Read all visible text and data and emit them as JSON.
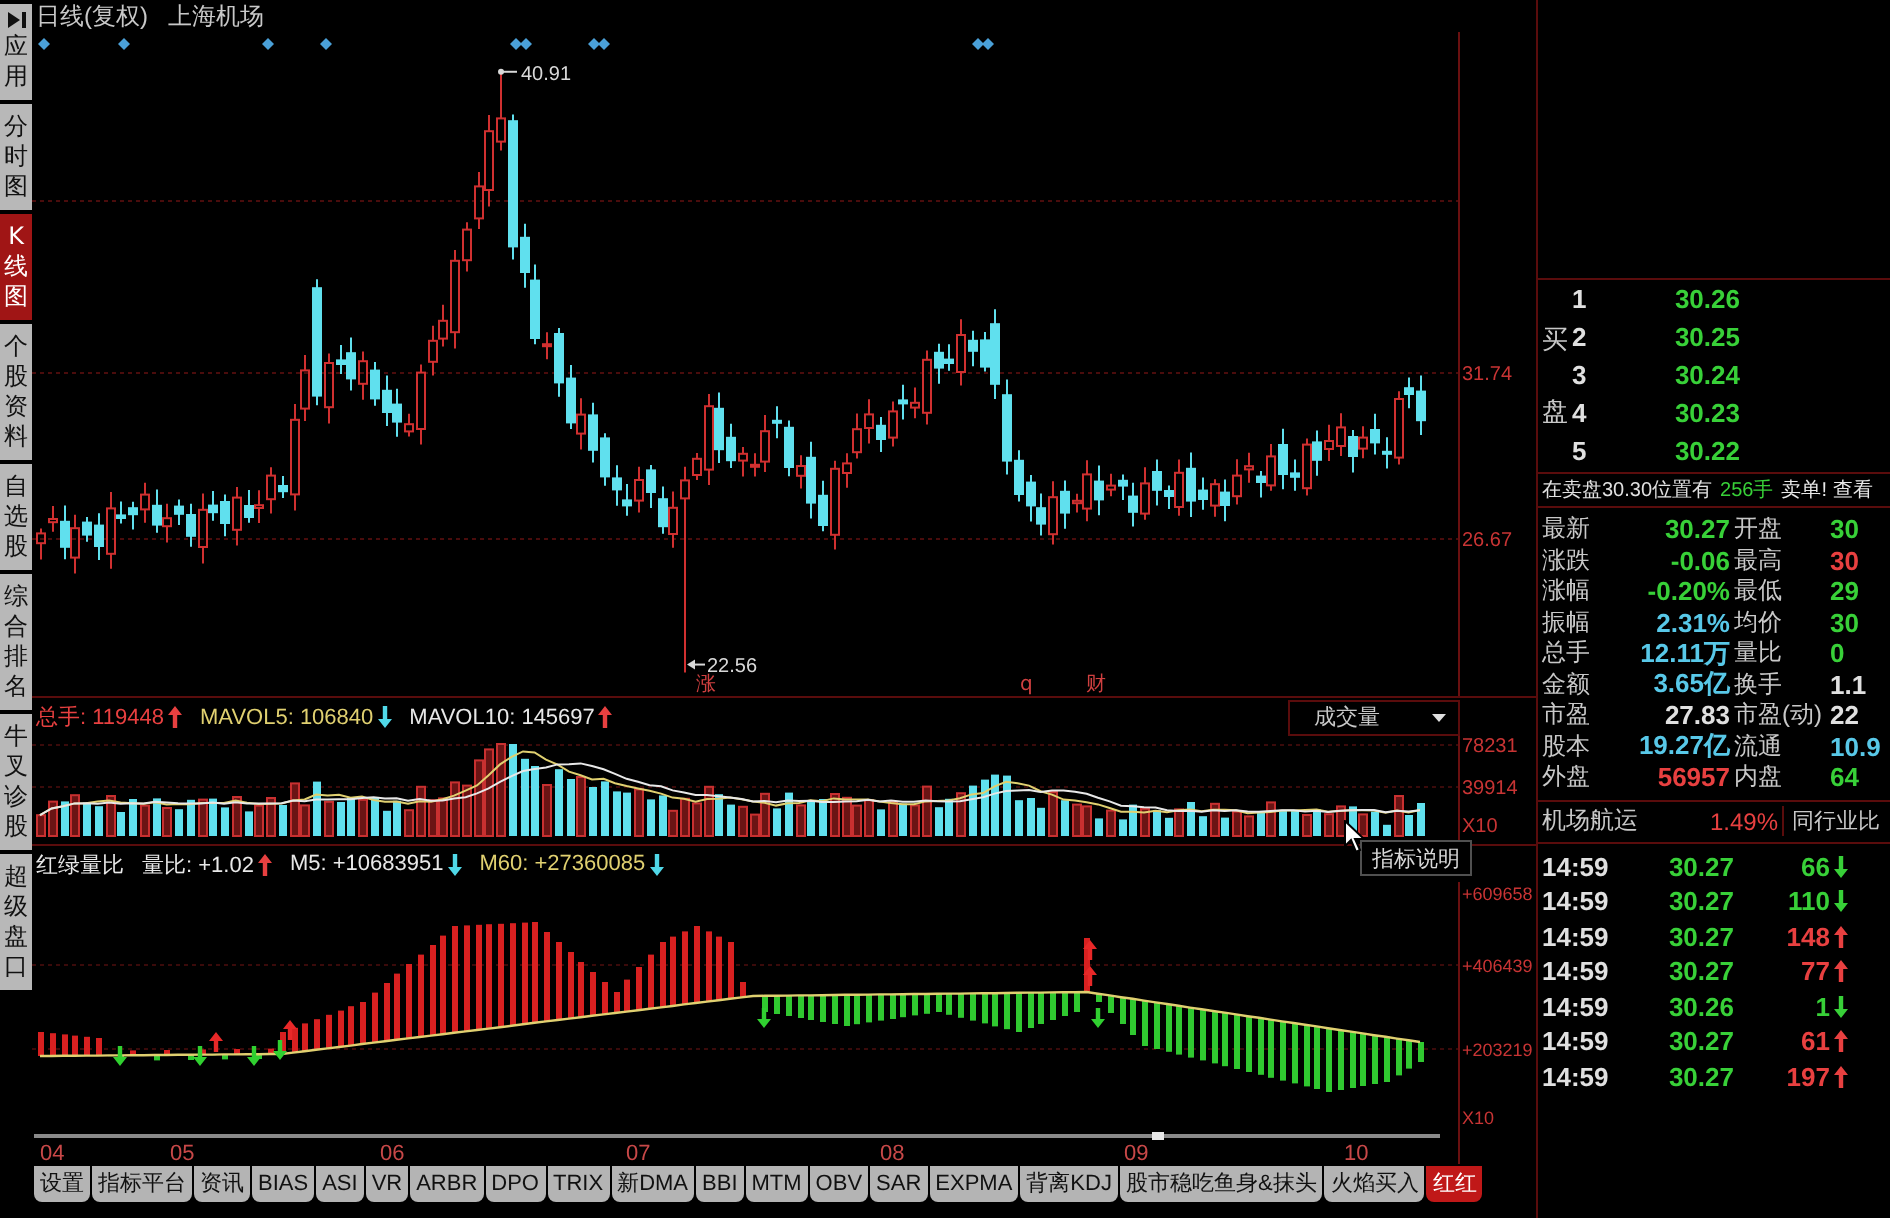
{
  "sidebar": {
    "tabs": [
      {
        "label": "应用",
        "kind": "menu",
        "selected": false
      },
      {
        "label": "分时图",
        "kind": "page",
        "selected": false
      },
      {
        "label": "K线图",
        "kind": "page",
        "selected": true
      },
      {
        "label": "个股资料",
        "kind": "page",
        "selected": false
      },
      {
        "label": "自选股",
        "kind": "page",
        "selected": false
      },
      {
        "label": "综合排名",
        "kind": "page",
        "selected": false
      },
      {
        "label": "牛叉诊股",
        "kind": "page",
        "selected": false
      },
      {
        "label": "超级盘口",
        "kind": "page",
        "selected": false
      }
    ]
  },
  "chart": {
    "title": "日线(复权)",
    "stock": "上海机场",
    "price_panel": {
      "axis_labels": [
        "31.74",
        "26.67"
      ],
      "high_label": "40.91",
      "low_label": "22.56",
      "event_marks": [
        "涨",
        "q",
        "财"
      ]
    },
    "volume_panel": {
      "legend": [
        {
          "text": "总手: 119448",
          "rising": true,
          "color": "#e84040"
        },
        {
          "text": "MAVOL5: 106840",
          "rising": false,
          "color": "#e0d070"
        },
        {
          "text": "MAVOL10: 145697",
          "rising": true,
          "color": "#e8e8e8"
        }
      ],
      "selector": "成交量",
      "axis_labels": [
        "78231",
        "39914",
        "X10"
      ]
    },
    "indicator_panel": {
      "name": "红绿量比",
      "legend": [
        {
          "text": "量比: +1.02",
          "rising": true,
          "color": "#e8e8e8"
        },
        {
          "text": "M5: +10683951",
          "rising": false,
          "color": "#e8e8e8"
        },
        {
          "text": "M60: +27360085",
          "rising": false,
          "color": "#e0d070"
        }
      ],
      "help_button": "指标说明",
      "axis_labels": [
        "+609658",
        "+406439",
        "+203219",
        "X10"
      ]
    },
    "date_labels": [
      "04",
      "05",
      "06",
      "07",
      "08",
      "09",
      "10"
    ],
    "indicator_tabs": [
      {
        "label": "设置",
        "selected": false
      },
      {
        "label": "指标平台",
        "selected": false
      },
      {
        "label": "资讯",
        "selected": false
      },
      {
        "label": "BIAS",
        "selected": false
      },
      {
        "label": "ASI",
        "selected": false
      },
      {
        "label": "VR",
        "selected": false
      },
      {
        "label": "ARBR",
        "selected": false
      },
      {
        "label": "DPO",
        "selected": false
      },
      {
        "label": "TRIX",
        "selected": false
      },
      {
        "label": "新DMA",
        "selected": false
      },
      {
        "label": "BBI",
        "selected": false
      },
      {
        "label": "MTM",
        "selected": false
      },
      {
        "label": "OBV",
        "selected": false
      },
      {
        "label": "SAR",
        "selected": false
      },
      {
        "label": "EXPMA",
        "selected": false
      },
      {
        "label": "背离KDJ",
        "selected": false
      },
      {
        "label": "股市稳吃鱼身&抹头",
        "selected": false
      },
      {
        "label": "火焰买入",
        "selected": false
      },
      {
        "label": "红红",
        "selected": true
      }
    ]
  },
  "quote_panel": {
    "bid_label": "买盘",
    "bids": [
      {
        "rank": "1",
        "price": "30.26"
      },
      {
        "rank": "2",
        "price": "30.25"
      },
      {
        "rank": "3",
        "price": "30.24"
      },
      {
        "rank": "4",
        "price": "30.23"
      },
      {
        "rank": "5",
        "price": "30.22"
      }
    ],
    "notice": {
      "text": "在卖盘30.30位置有",
      "volume": "256手",
      "link": "卖单! 查看"
    },
    "stats": [
      {
        "label": "最新",
        "value": "30.27",
        "color": "#38d038"
      },
      {
        "label": "开盘",
        "value": "30",
        "color": "#38d038"
      },
      {
        "label": "涨跌",
        "value": "-0.06",
        "color": "#38d038"
      },
      {
        "label": "最高",
        "value": "30",
        "color": "#e84040"
      },
      {
        "label": "涨幅",
        "value": "-0.20%",
        "color": "#38d038"
      },
      {
        "label": "最低",
        "value": "29",
        "color": "#38d038"
      },
      {
        "label": "振幅",
        "value": "2.31%",
        "color": "#58c8e8"
      },
      {
        "label": "均价",
        "value": "30",
        "color": "#38d038"
      },
      {
        "label": "总手",
        "value": "12.11万",
        "color": "#58c8e8"
      },
      {
        "label": "量比",
        "value": "0",
        "color": "#38d038"
      },
      {
        "label": "金额",
        "value": "3.65亿",
        "color": "#58c8e8"
      },
      {
        "label": "换手",
        "value": "1.1",
        "color": "#e0e0e0"
      },
      {
        "label": "市盈",
        "value": "27.83",
        "color": "#e0e0e0"
      },
      {
        "label": "市盈(动)",
        "value": "22",
        "color": "#e0e0e0"
      },
      {
        "label": "股本",
        "value": "19.27亿",
        "color": "#58c8e8"
      },
      {
        "label": "流通",
        "value": "10.9",
        "color": "#58c8e8"
      },
      {
        "label": "外盘",
        "value": "56957",
        "color": "#e84040"
      },
      {
        "label": "内盘",
        "value": "64",
        "color": "#38d038"
      }
    ],
    "industry": {
      "name": "机场航运",
      "change": "1.49%",
      "compare": "同行业比"
    },
    "ticks": [
      {
        "time": "14:59",
        "price": "30.27",
        "volume": "66",
        "rising": false
      },
      {
        "time": "14:59",
        "price": "30.27",
        "volume": "110",
        "rising": false
      },
      {
        "time": "14:59",
        "price": "30.27",
        "volume": "148",
        "rising": true
      },
      {
        "time": "14:59",
        "price": "30.27",
        "volume": "77",
        "rising": true
      },
      {
        "time": "14:59",
        "price": "30.26",
        "volume": "1",
        "rising": false
      },
      {
        "time": "14:59",
        "price": "30.27",
        "volume": "61",
        "rising": true
      },
      {
        "time": "14:59",
        "price": "30.27",
        "volume": "197",
        "rising": true
      }
    ]
  }
}
